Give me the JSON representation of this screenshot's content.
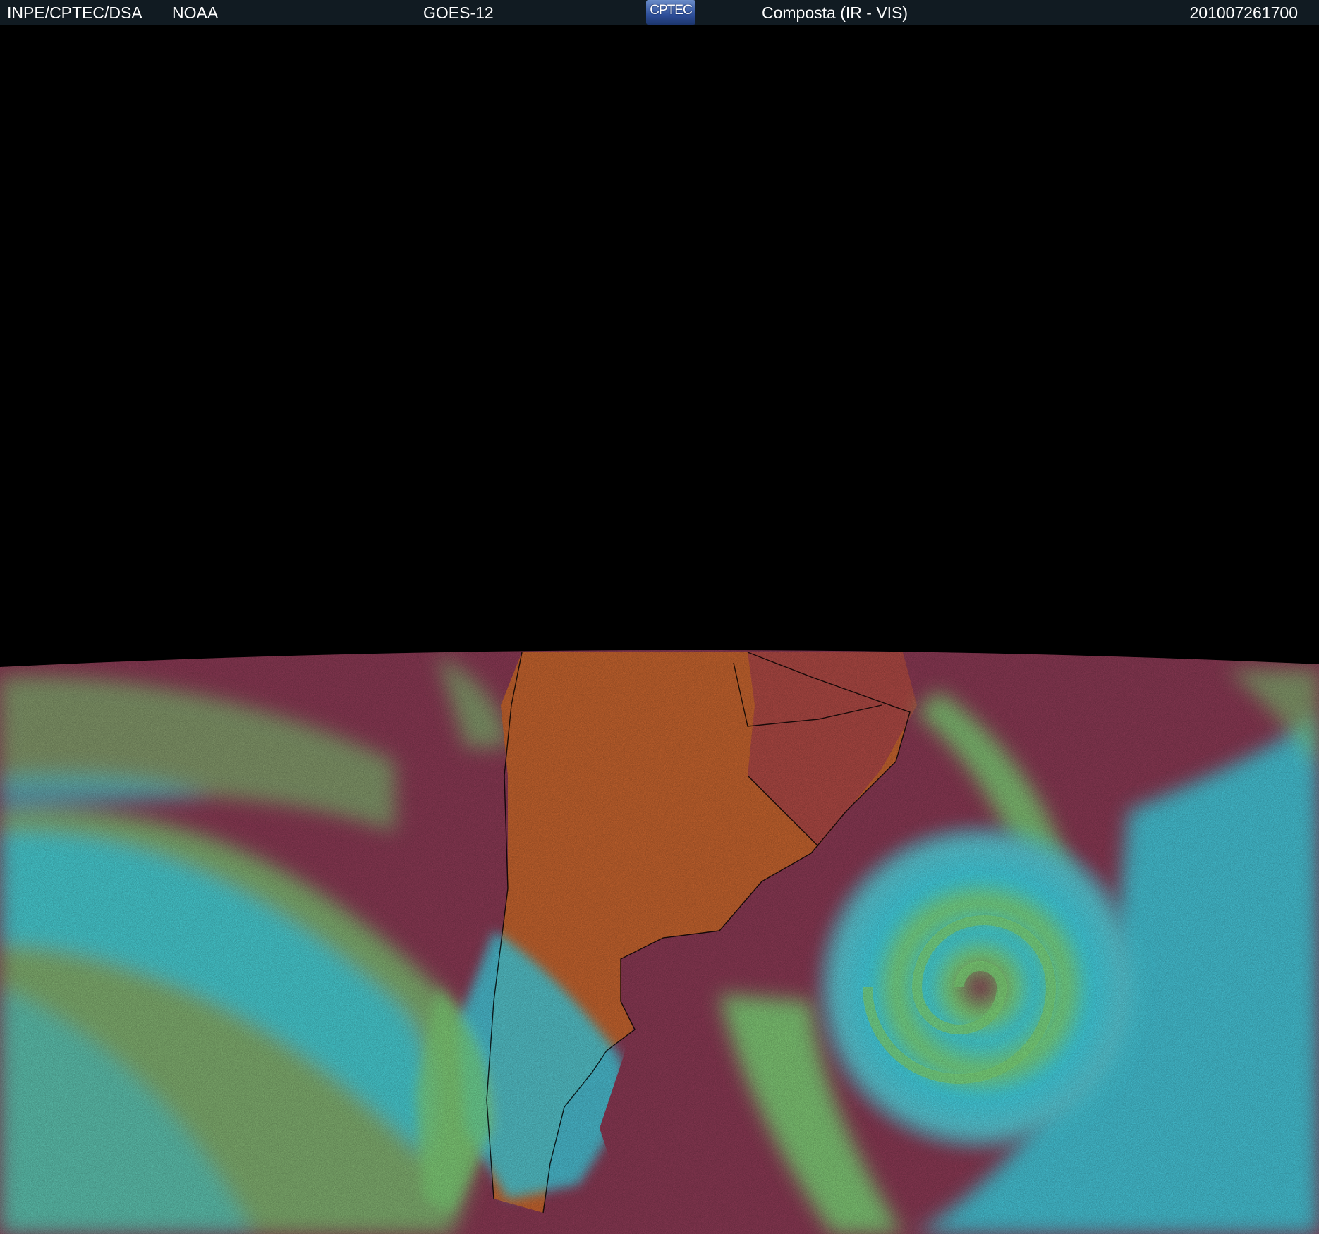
{
  "header": {
    "organization": "INPE/CPTEC/DSA",
    "agency": "NOAA",
    "satellite": "GOES-12",
    "logo_text": "CPTEC",
    "product": "Composta (IR - VIS)",
    "timestamp": "201007261700"
  },
  "colors": {
    "header_bg": "#111b22",
    "space": "#000000",
    "dry_land": "#c8652f",
    "clear_ocean": "#8c3a55",
    "low_cloud": "#7fd97a",
    "high_cloud": "#3fd4e6"
  }
}
